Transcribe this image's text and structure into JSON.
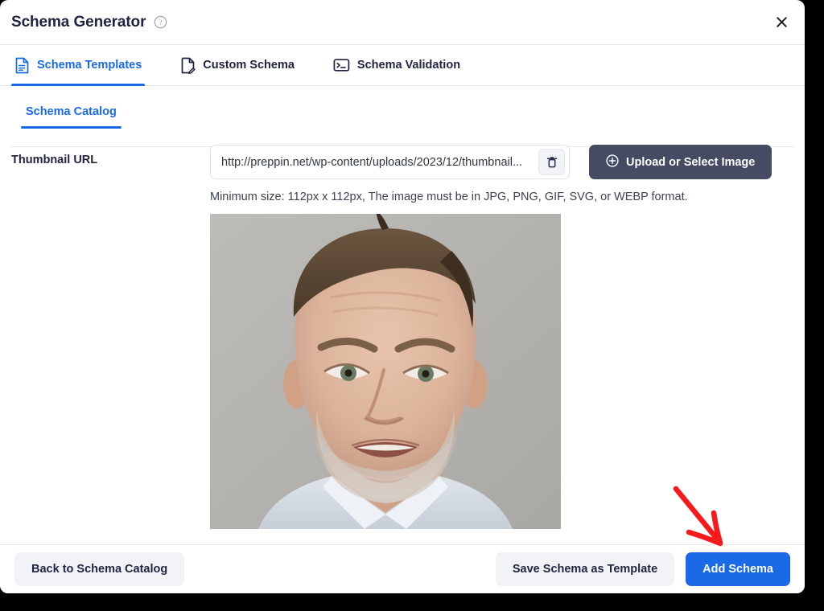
{
  "window": {
    "title": "Schema Generator",
    "help_icon": "help-circle-icon",
    "close_icon": "✕"
  },
  "tabs": [
    {
      "label": "Schema Templates",
      "icon": "document-icon",
      "active": true
    },
    {
      "label": "Custom Schema",
      "icon": "document-edit-icon",
      "active": false
    },
    {
      "label": "Schema Validation",
      "icon": "terminal-icon",
      "active": false
    }
  ],
  "subtabs": [
    {
      "label": "Schema Catalog",
      "active": true
    }
  ],
  "form": {
    "thumbnail_label": "Thumbnail URL",
    "url_value": "http://preppin.net/wp-content/uploads/2023/12/thumbnail...",
    "url_placeholder": "Enter thumbnail URL",
    "delete_icon": "trash-icon",
    "upload_button": "Upload or Select Image",
    "upload_icon": "plus-circle-icon",
    "hint": "Minimum size: 112px x 112px, The image must be in JPG, PNG, GIF, SVG, or WEBP format.",
    "preview_alt": "Thumbnail preview: portrait photo of a man against a light gray wall"
  },
  "footer": {
    "back_button": "Back to Schema Catalog",
    "save_button": "Save Schema as Template",
    "add_button": "Add Schema"
  },
  "annotation": {
    "arrow": "red-arrow-pointing-to-add-schema"
  },
  "colors": {
    "accent": "#1a6ae8",
    "dark_button": "#454b63",
    "text": "#1f2340",
    "annotation_red": "#f81a1a",
    "border": "#e6e8ec"
  }
}
